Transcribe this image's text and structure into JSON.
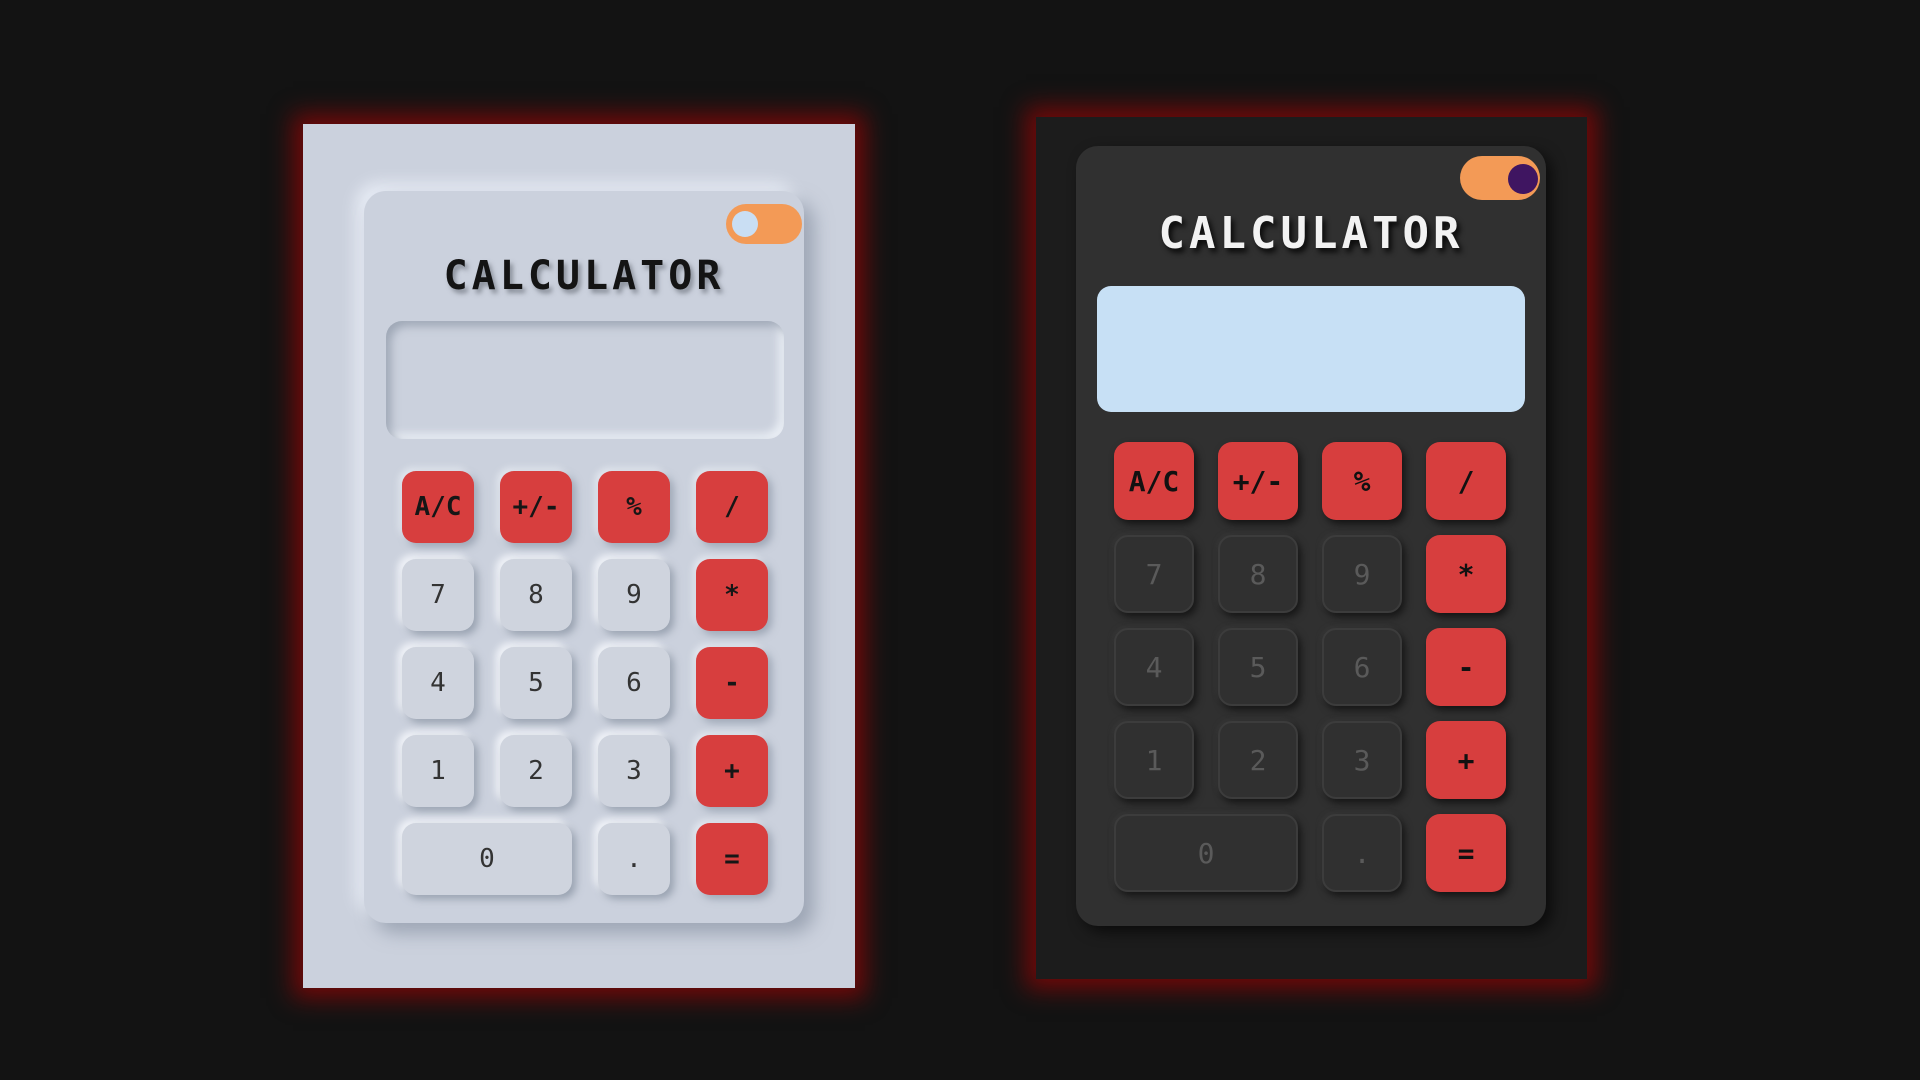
{
  "calculators": [
    {
      "theme": "light",
      "title": "CALCULATOR",
      "display_value": "",
      "toggle": "off",
      "keys": [
        "A/C",
        "+/-",
        "%",
        "/",
        "7",
        "8",
        "9",
        "*",
        "4",
        "5",
        "6",
        "-",
        "1",
        "2",
        "3",
        "+",
        "0",
        ".",
        "="
      ]
    },
    {
      "theme": "dark",
      "title": "CALCULATOR",
      "display_value": "",
      "toggle": "on",
      "keys": [
        "A/C",
        "+/-",
        "%",
        "/",
        "7",
        "8",
        "9",
        "*",
        "4",
        "5",
        "6",
        "-",
        "1",
        "2",
        "3",
        "+",
        "0",
        ".",
        "="
      ]
    }
  ],
  "colors": {
    "background": "#131313",
    "glow": "#be0000",
    "accent_red": "#d73e3e",
    "toggle_orange": "#f39a56",
    "light_surface": "#cbd1dd",
    "dark_surface": "#303030",
    "dark_display": "#c7e0f5",
    "dark_toggle_knob": "#3f1561"
  }
}
